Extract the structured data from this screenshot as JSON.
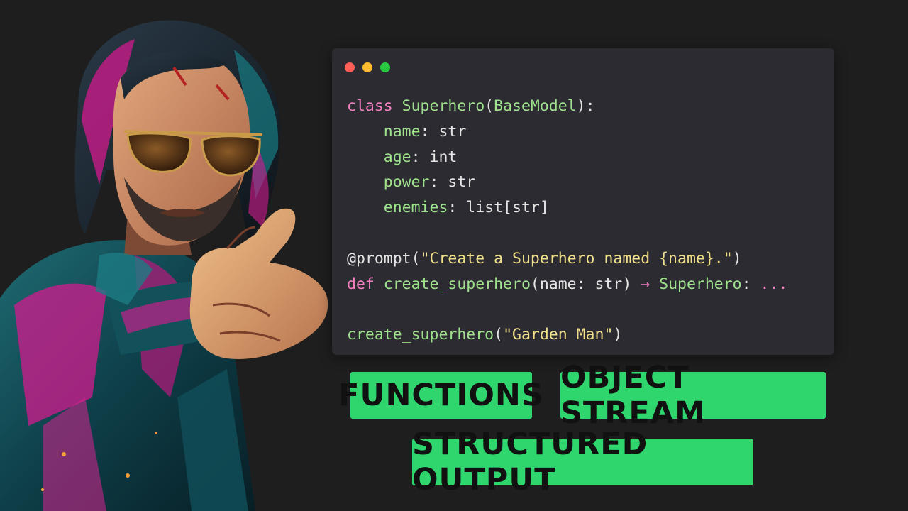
{
  "code": {
    "lines": [
      [
        {
          "c": "kw",
          "t": "class "
        },
        {
          "c": "cls",
          "t": "Superhero"
        },
        {
          "c": "plain",
          "t": "("
        },
        {
          "c": "cls",
          "t": "BaseModel"
        },
        {
          "c": "plain",
          "t": "):"
        }
      ],
      [
        {
          "c": "plain",
          "t": "    "
        },
        {
          "c": "attr",
          "t": "name"
        },
        {
          "c": "plain",
          "t": ": str"
        }
      ],
      [
        {
          "c": "plain",
          "t": "    "
        },
        {
          "c": "attr",
          "t": "age"
        },
        {
          "c": "plain",
          "t": ": int"
        }
      ],
      [
        {
          "c": "plain",
          "t": "    "
        },
        {
          "c": "attr",
          "t": "power"
        },
        {
          "c": "plain",
          "t": ": str"
        }
      ],
      [
        {
          "c": "plain",
          "t": "    "
        },
        {
          "c": "attr",
          "t": "enemies"
        },
        {
          "c": "plain",
          "t": ": list[str]"
        }
      ],
      [],
      [
        {
          "c": "dec",
          "t": "@prompt("
        },
        {
          "c": "str",
          "t": "\"Create a Superhero named {name}.\""
        },
        {
          "c": "dec",
          "t": ")"
        }
      ],
      [
        {
          "c": "kw",
          "t": "def "
        },
        {
          "c": "fn",
          "t": "create_superhero"
        },
        {
          "c": "plain",
          "t": "(name: str) "
        },
        {
          "c": "arrow",
          "t": "→"
        },
        {
          "c": "cls",
          "t": " Superhero"
        },
        {
          "c": "plain",
          "t": ": "
        },
        {
          "c": "ell",
          "t": "..."
        }
      ],
      [],
      [
        {
          "c": "fn",
          "t": "create_superhero"
        },
        {
          "c": "plain",
          "t": "("
        },
        {
          "c": "str",
          "t": "\"Garden Man\""
        },
        {
          "c": "plain",
          "t": ")"
        }
      ]
    ]
  },
  "labels": {
    "functions": "FUNCTIONS",
    "object_stream": "OBJECT STREAM",
    "structured_output": "STRUCTURED OUTPUT"
  },
  "colors": {
    "background": "#1e1e1e",
    "code_background": "#2b2b31",
    "label_background": "#2fd66e",
    "keyword": "#f47fc0",
    "type": "#9ee28c",
    "string": "#f0e08a"
  },
  "figure": {
    "icon": "pointing-man-illustration"
  }
}
